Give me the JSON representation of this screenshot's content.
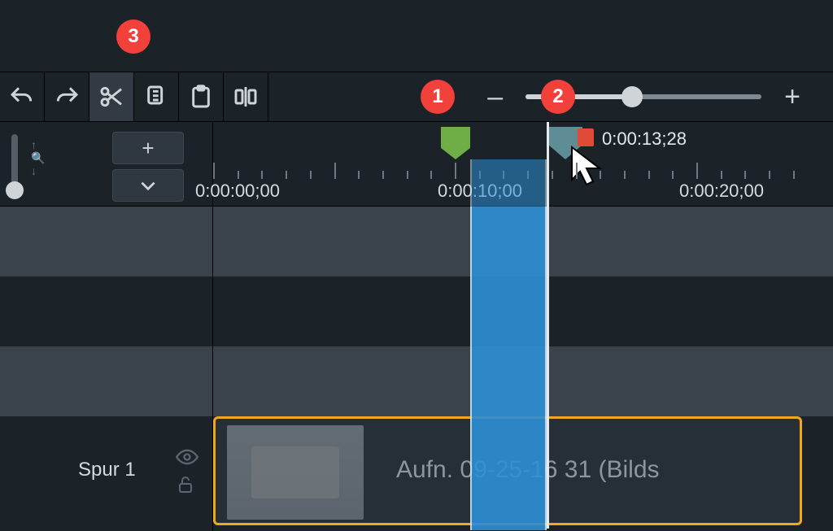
{
  "callouts": {
    "c1": "1",
    "c2": "2",
    "c3": "3"
  },
  "toolbar": {
    "undo": "undo",
    "redo": "redo",
    "cut": "cut",
    "copy": "copy",
    "paste": "paste",
    "split": "split",
    "zoom_minus": "–",
    "zoom_plus": "+",
    "zoom_value": 0.45
  },
  "ruler": {
    "labels": [
      "0:00:00;00",
      "0:00:10;00",
      "0:00:20;00"
    ],
    "playhead_time": "0:00:13;28"
  },
  "track": {
    "name": "Spur 1",
    "clip_label": "Aufn. 09-25-16 31 (Bilds"
  },
  "leftcol": {
    "plus": "+",
    "chevron": "⌄"
  }
}
